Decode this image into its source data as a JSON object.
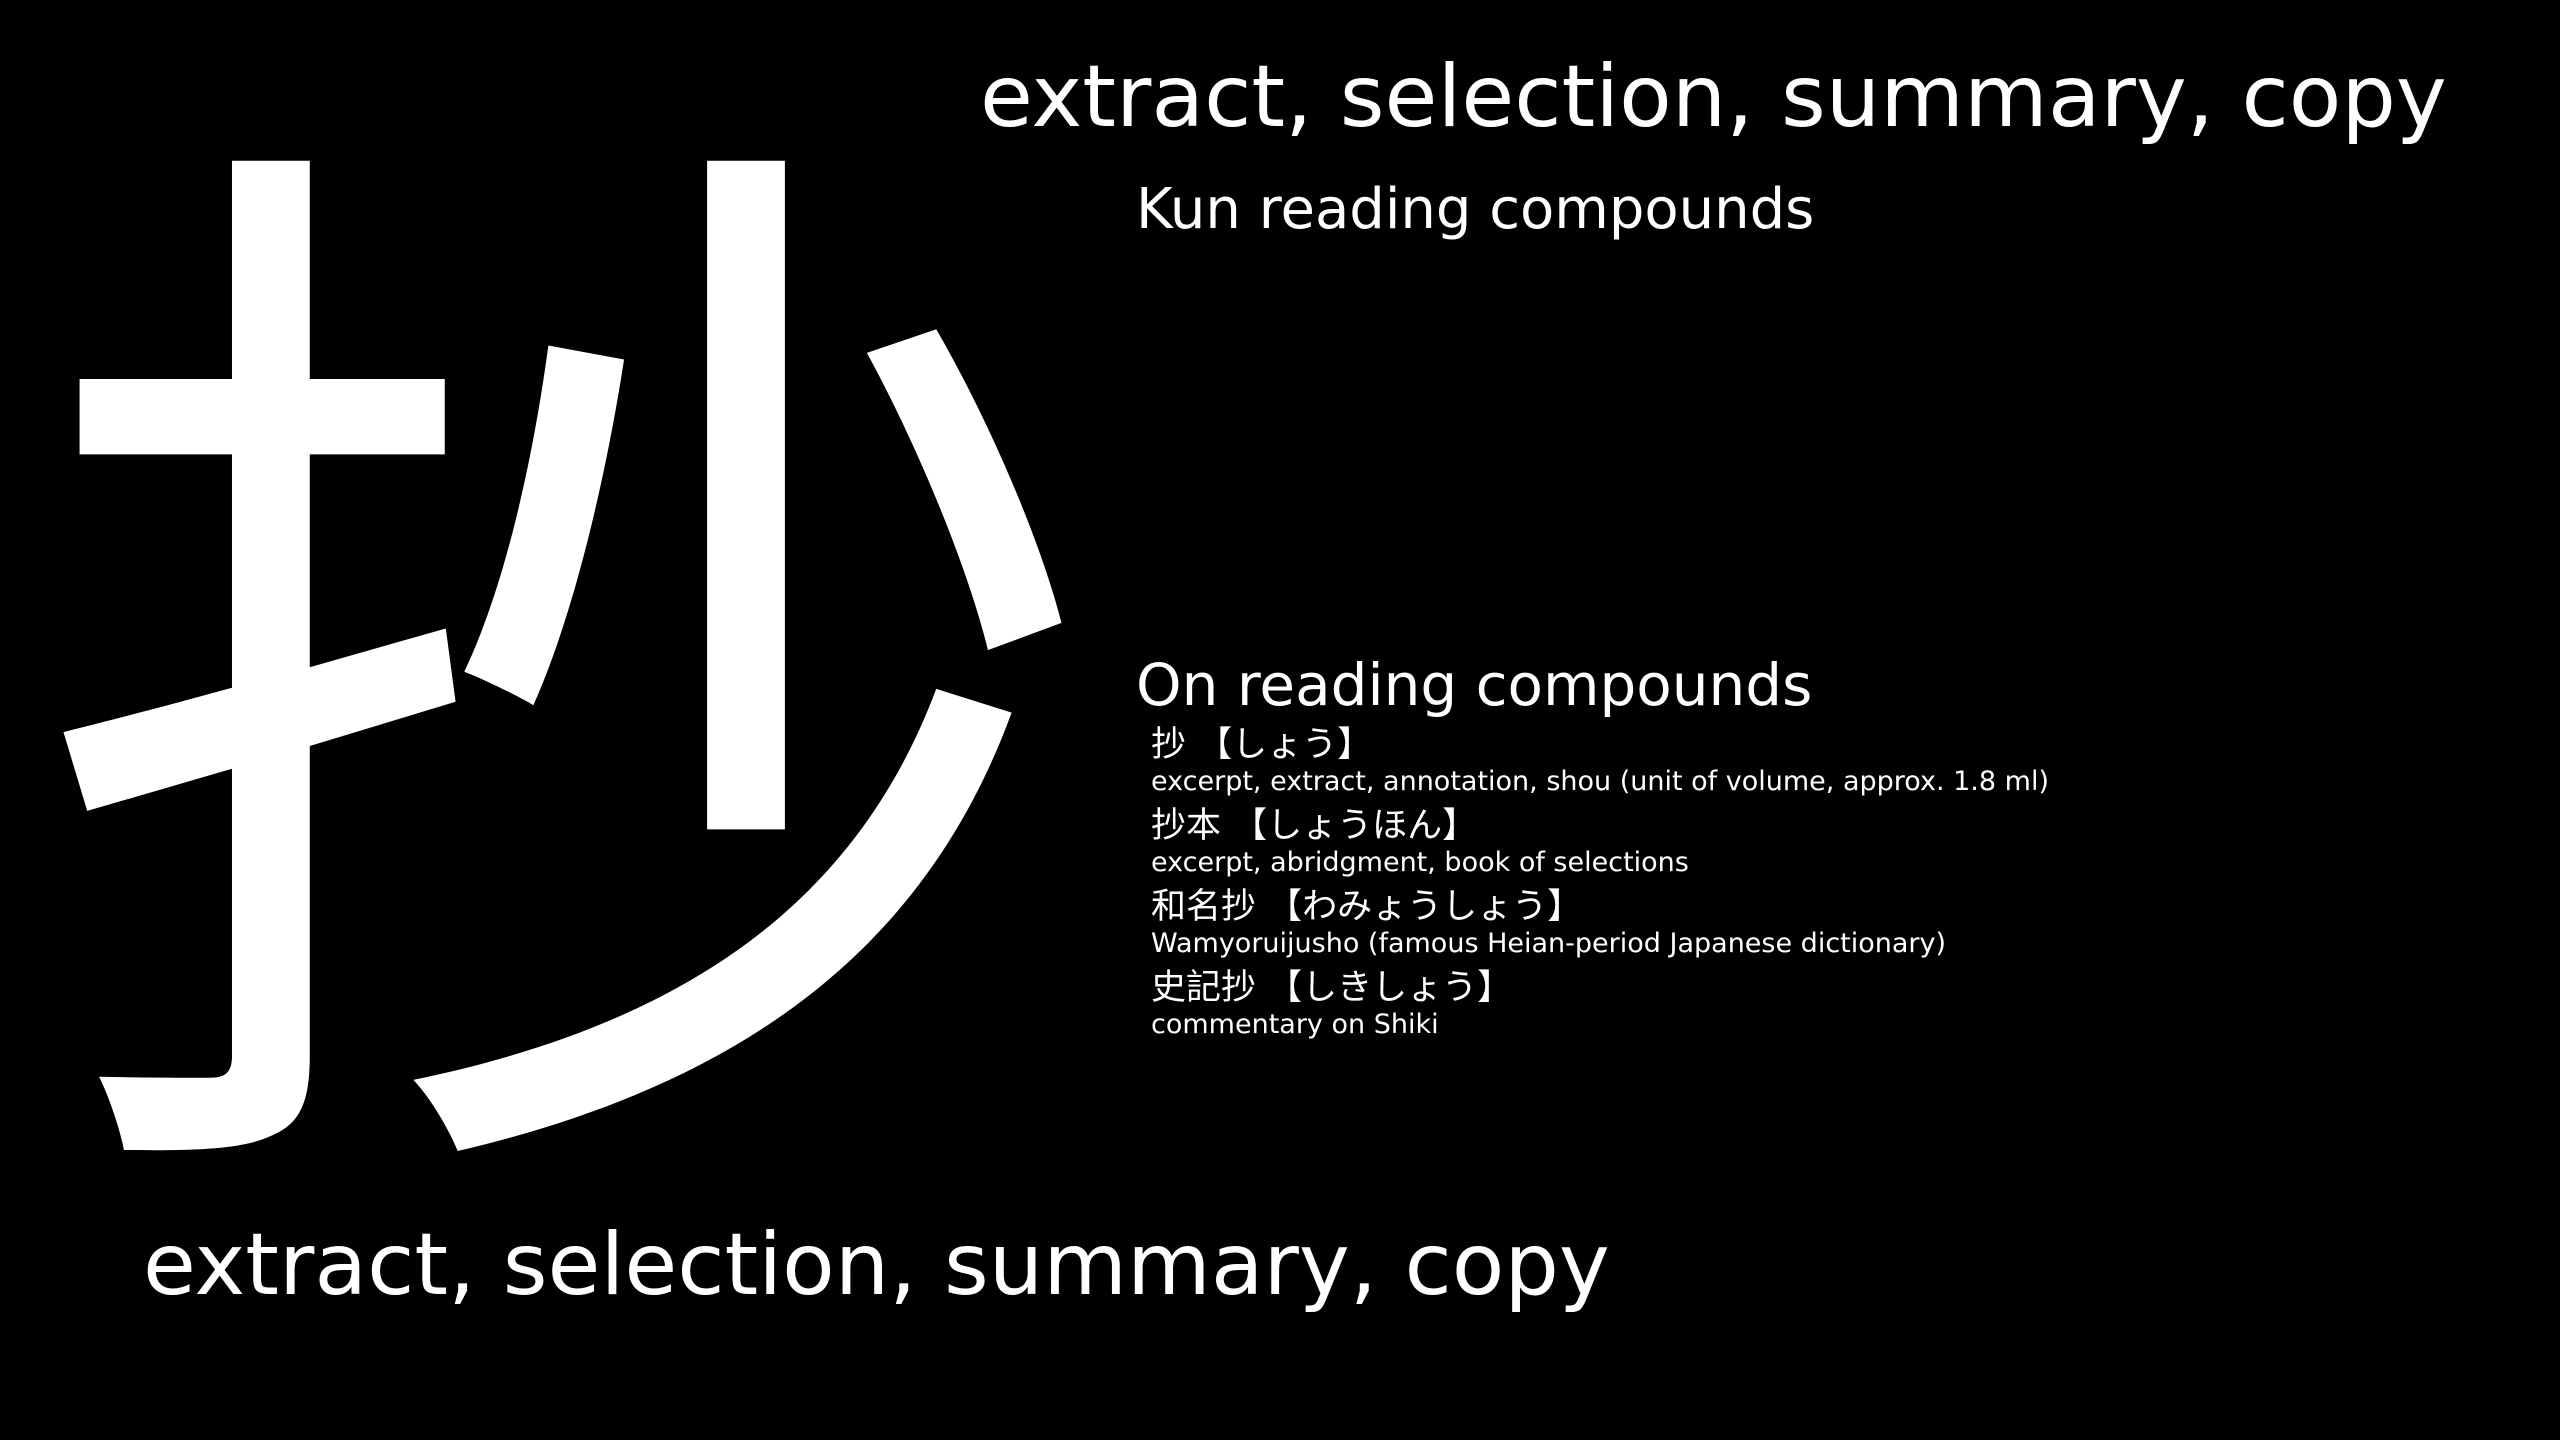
{
  "kanji": "抄",
  "meaning_top": "extract, selection, summary, copy",
  "kun_heading": "Kun reading compounds",
  "on_heading": "On reading compounds",
  "on_compounds": [
    {
      "word": "抄 【しょう】",
      "definition": "excerpt, extract, annotation, shou (unit of volume, approx. 1.8 ml)"
    },
    {
      "word": "抄本 【しょうほん】",
      "definition": "excerpt, abridgment, book of selections"
    },
    {
      "word": "和名抄 【わみょうしょう】",
      "definition": "Wamyoruijusho (famous Heian-period Japanese dictionary)"
    },
    {
      "word": "史記抄 【しきしょう】",
      "definition": "commentary on Shiki"
    }
  ],
  "meaning_bottom": "extract, selection, summary, copy",
  "colors": {
    "background": "#000000",
    "text": "#ffffff"
  }
}
